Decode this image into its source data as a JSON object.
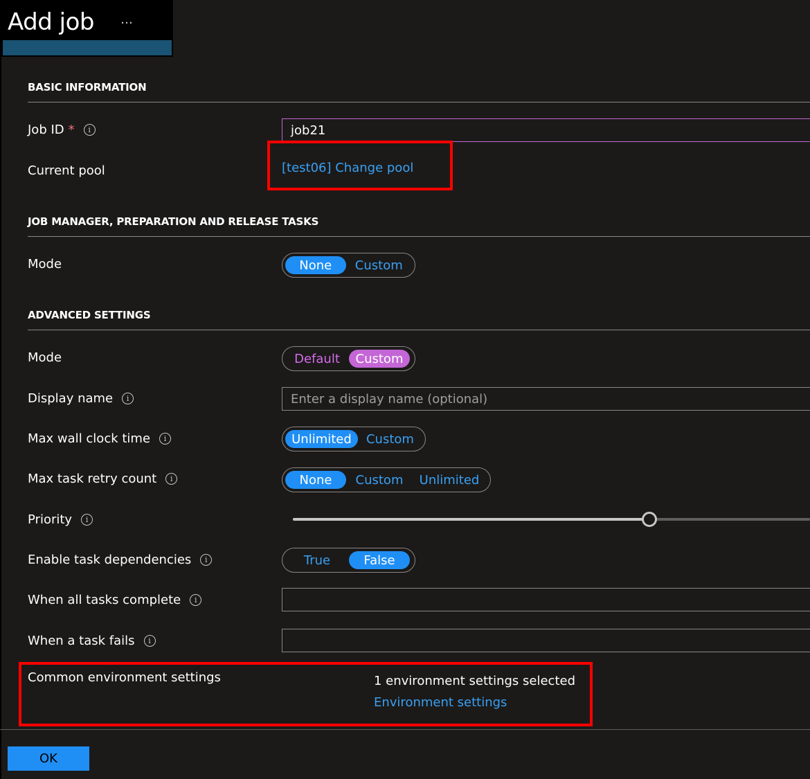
{
  "header": {
    "title": "Add job",
    "more_icon": "…"
  },
  "basic": {
    "section_title": "BASIC INFORMATION",
    "job_id_label": "Job ID",
    "required_mark": "*",
    "job_id_value": "job21",
    "current_pool_label": "Current pool",
    "current_pool_link": "[test06] Change pool"
  },
  "tasks": {
    "section_title": "JOB MANAGER, PREPARATION AND RELEASE TASKS",
    "mode_label": "Mode",
    "mode_options": [
      "None",
      "Custom"
    ],
    "mode_selected": "None"
  },
  "advanced": {
    "section_title": "ADVANCED SETTINGS",
    "mode_label": "Mode",
    "mode_options": [
      "Default",
      "Custom"
    ],
    "mode_selected": "Custom",
    "display_name_label": "Display name",
    "display_name_placeholder": "Enter a display name (optional)",
    "max_wall_label": "Max wall clock time",
    "max_wall_options": [
      "Unlimited",
      "Custom"
    ],
    "max_wall_selected": "Unlimited",
    "max_retry_label": "Max task retry count",
    "max_retry_options": [
      "None",
      "Custom",
      "Unlimited"
    ],
    "max_retry_selected": "None",
    "priority_label": "Priority",
    "priority_level_fraction": 0.69,
    "deps_label": "Enable task dependencies",
    "deps_options": [
      "True",
      "False"
    ],
    "deps_selected": "False",
    "all_complete_label": "When all tasks complete",
    "task_fails_label": "When a task fails",
    "env_label": "Common environment settings",
    "env_count": "1 environment settings selected",
    "env_link": "Environment settings"
  },
  "footer": {
    "ok_label": "OK"
  },
  "colors": {
    "accent_blue": "#1f8ff5",
    "accent_pink": "#c466d6",
    "highlight_red": "#ff0000",
    "background": "#1b1a19"
  }
}
